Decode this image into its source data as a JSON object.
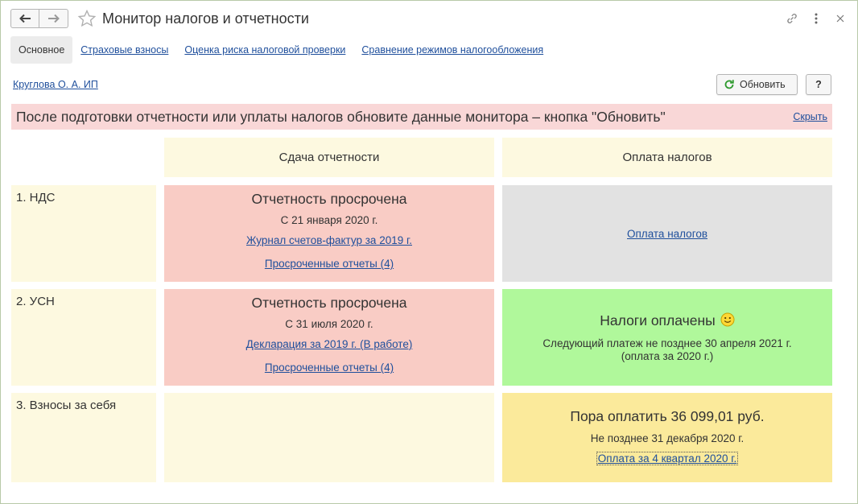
{
  "window": {
    "title": "Монитор налогов и отчетности"
  },
  "tabs": [
    {
      "label": "Основное",
      "active": true
    },
    {
      "label": "Страховые взносы",
      "active": false
    },
    {
      "label": "Оценка риска налоговой проверки",
      "active": false
    },
    {
      "label": "Сравнение режимов налогообложения",
      "active": false
    }
  ],
  "org_link": "Круглова О. А. ИП",
  "toolbar": {
    "refresh_label": "Обновить",
    "help_label": "?"
  },
  "banner": {
    "text": "После подготовки отчетности или уплаты налогов обновите данные монитора – кнопка \"Обновить\"",
    "hide_label": "Скрыть"
  },
  "columns": {
    "reporting": "Сдача отчетности",
    "payment": "Оплата налогов"
  },
  "rows": [
    {
      "label": "1. НДС",
      "reporting": {
        "status": "Отчетность просрочена",
        "date": "С 21 января 2020 г.",
        "link1": "Журнал счетов-фактур за 2019 г.",
        "link2": "Просроченные отчеты (4)"
      },
      "payment": {
        "link": "Оплата налогов"
      }
    },
    {
      "label": "2. УСН",
      "reporting": {
        "status": "Отчетность просрочена",
        "date": "С 31 июля 2020 г.",
        "link1": "Декларация за 2019 г. (В работе)",
        "link2": "Просроченные отчеты (4)"
      },
      "payment": {
        "status": "Налоги оплачены",
        "note_line1": "Следующий платеж не позднее 30 апреля 2021 г.",
        "note_line2": "(оплата за 2020 г.)"
      }
    },
    {
      "label": "3. Взносы за себя",
      "reporting": {},
      "payment": {
        "status": "Пора оплатить 36 099,01 руб.",
        "date": "Не позднее 31 декабря 2020 г.",
        "link": "Оплата за 4 квартал 2020 г."
      }
    }
  ],
  "colors": {
    "overdue": "#f9ccc5",
    "neutral": "#e2e2e2",
    "paid": "#b0f89b",
    "due": "#fbea9b",
    "header": "#fdf9e0",
    "banner": "#f9d7d7",
    "link": "#1f4f9c"
  }
}
